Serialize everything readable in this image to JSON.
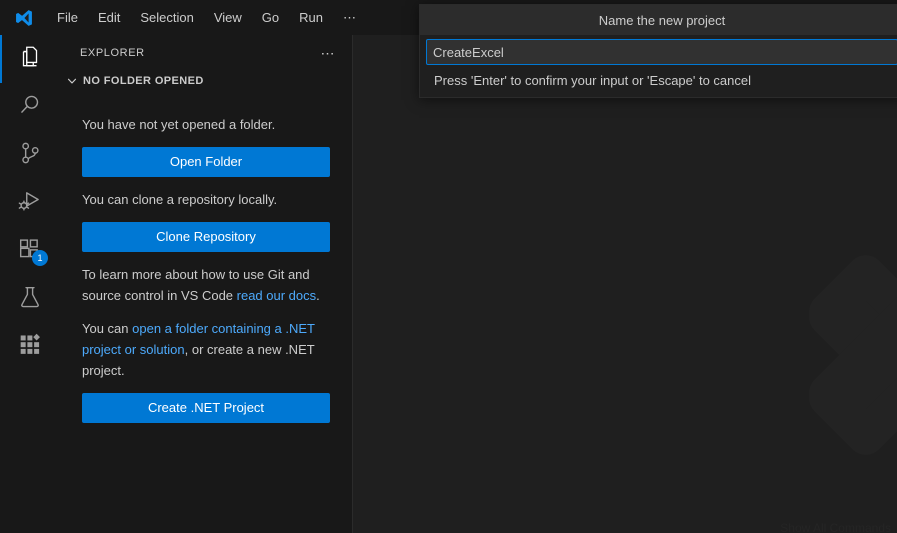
{
  "titlebar": {
    "logo_icon": "vscode-logo-icon",
    "menus": [
      {
        "label": "File"
      },
      {
        "label": "Edit"
      },
      {
        "label": "Selection"
      },
      {
        "label": "View"
      },
      {
        "label": "Go"
      },
      {
        "label": "Run"
      },
      {
        "label": "⋯"
      }
    ]
  },
  "activitybar": {
    "items": [
      {
        "name": "explorer",
        "icon": "files-icon",
        "active": true,
        "badge": null
      },
      {
        "name": "search",
        "icon": "search-icon",
        "active": false,
        "badge": null
      },
      {
        "name": "source-control",
        "icon": "source-control-icon",
        "active": false,
        "badge": null
      },
      {
        "name": "run-and-debug",
        "icon": "run-and-debug-icon",
        "active": false,
        "badge": null
      },
      {
        "name": "extensions",
        "icon": "extensions-icon",
        "active": false,
        "badge": "1"
      },
      {
        "name": "testing",
        "icon": "beaker-icon",
        "active": false,
        "badge": null
      },
      {
        "name": "apps-grid",
        "icon": "apps-grid-icon",
        "active": false,
        "badge": null
      }
    ]
  },
  "sidebar": {
    "title": "EXPLORER",
    "actions_icon": "more-actions-icon",
    "section": {
      "chevron_icon": "chevron-down-icon",
      "title": "NO FOLDER OPENED"
    },
    "blocks": {
      "no_folder_text": "You have not yet opened a folder.",
      "open_folder_button": "Open Folder",
      "clone_text": "You can clone a repository locally.",
      "clone_button": "Clone Repository",
      "git_text_prefix": "To learn more about how to use Git and source control in VS Code ",
      "git_link": "read our docs",
      "git_text_suffix": ".",
      "dotnet_text_prefix": "You can ",
      "dotnet_link": "open a folder containing a .NET project or solution",
      "dotnet_text_suffix": ", or create a new .NET project.",
      "create_dotnet_button": "Create .NET Project"
    }
  },
  "editor": {
    "watermark_icon": "vscode-watermark-logo-icon",
    "bottom_hint": "Show All Commands"
  },
  "quickinput": {
    "title": "Name the new project",
    "input_value": "CreateExcel",
    "input_placeholder": "",
    "message": "Press 'Enter' to confirm your input or 'Escape' to cancel"
  },
  "colors": {
    "accent": "#0078d4",
    "link": "#4daafc",
    "sidebar_bg": "#181818",
    "editor_bg": "#1f1f1f",
    "text": "#cccccc"
  }
}
